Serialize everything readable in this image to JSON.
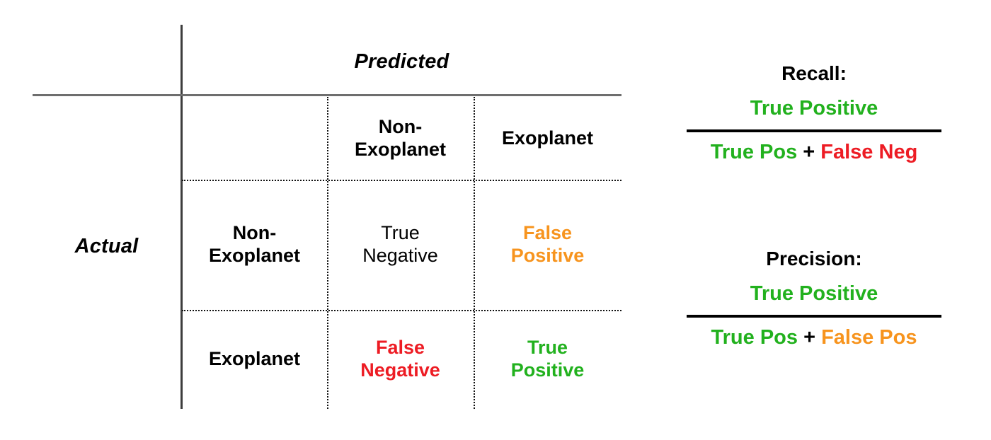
{
  "matrix": {
    "axis_predicted_label": "Predicted",
    "axis_actual_label": "Actual",
    "column_headers": [
      "Non-\nExoplanet",
      "Exoplanet"
    ],
    "row_headers": [
      "Non-\nExoplanet",
      "Exoplanet"
    ],
    "cells": [
      {
        "text": "True\nNegative",
        "color": "#000000",
        "weight": "plain"
      },
      {
        "text": "False\nPositive",
        "color": "#F7941E",
        "weight": "bold"
      },
      {
        "text": "False\nNegative",
        "color": "#ED1C24",
        "weight": "bold"
      },
      {
        "text": "True\nPositive",
        "color": "#22B11E",
        "weight": "bold"
      }
    ]
  },
  "formulas": {
    "recall": {
      "title": "Recall:",
      "numerator": "True Positive",
      "numerator_color": "#22B11E",
      "denominator_left": "True Pos",
      "denominator_left_color": "#22B11E",
      "denominator_operator": " + ",
      "denominator_right": "False Neg",
      "denominator_right_color": "#ED1C24"
    },
    "precision": {
      "title": "Precision:",
      "numerator": "True Positive",
      "numerator_color": "#22B11E",
      "denominator_left": "True Pos",
      "denominator_left_color": "#22B11E",
      "denominator_operator": " + ",
      "denominator_right": "False Pos",
      "denominator_right_color": "#F7941E"
    }
  },
  "colors": {
    "true_positive": "#22B11E",
    "false_positive": "#F7941E",
    "false_negative": "#ED1C24",
    "true_negative": "#000000",
    "rule": "#000000",
    "axis": "#3d3d3d",
    "background": "#ffffff"
  }
}
